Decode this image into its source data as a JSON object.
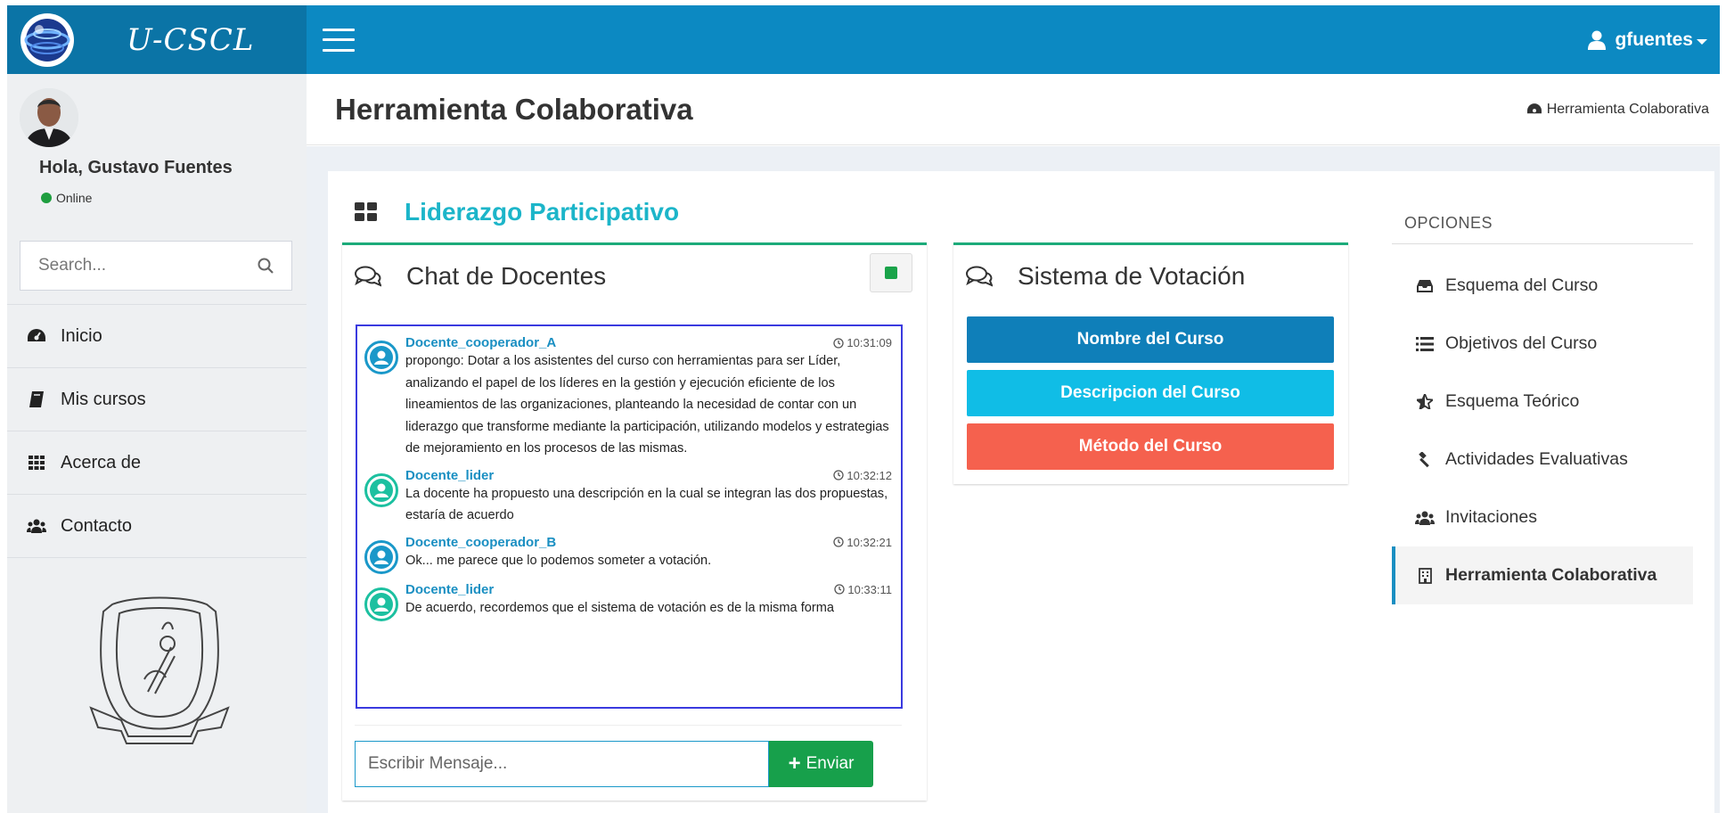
{
  "app": {
    "brand": "U-CSCL"
  },
  "header": {
    "username": "gfuentes"
  },
  "sidebar": {
    "greeting": "Hola, Gustavo Fuentes",
    "status": "Online",
    "search_placeholder": "Search...",
    "items": [
      {
        "label": "Inicio",
        "icon": "dashboard-icon"
      },
      {
        "label": "Mis cursos",
        "icon": "book-icon"
      },
      {
        "label": "Acerca de",
        "icon": "grid-icon"
      },
      {
        "label": "Contacto",
        "icon": "users-icon"
      }
    ]
  },
  "page": {
    "title": "Herramienta Colaborativa",
    "breadcrumb": "Herramienta Colaborativa",
    "section_title": "Liderazgo Participativo"
  },
  "chat": {
    "title": "Chat de Docentes",
    "messages": [
      {
        "author": "Docente_cooperador_A",
        "time": "10:31:09",
        "text": "propongo: Dotar a los asistentes del curso con herramientas para ser Líder, analizando el papel de los líderes en la gestión y ejecución eficiente de los lineamientos de las organizaciones, planteando la necesidad de contar con un liderazgo que transforme mediante la participación, utilizando modelos y estrategias de mejoramiento en los procesos de las mismas."
      },
      {
        "author": "Docente_lider",
        "time": "10:32:12",
        "text": "La docente ha propuesto una descripción en la cual se integran las dos propuestas, estaría de acuerdo"
      },
      {
        "author": "Docente_cooperador_B",
        "time": "10:32:21",
        "text": "Ok... me parece que lo podemos someter a votación."
      },
      {
        "author": "Docente_lider",
        "time": "10:33:11",
        "text": "De acuerdo, recordemos que el sistema de votación es de la misma forma"
      }
    ],
    "input_placeholder": "Escribir Mensaje...",
    "send_label": "Enviar"
  },
  "vote": {
    "title": "Sistema de Votación",
    "buttons": [
      {
        "label": "Nombre del Curso",
        "color": "#0f7fb9"
      },
      {
        "label": "Descripcion del Curso",
        "color": "#10bde6"
      },
      {
        "label": "Método del Curso",
        "color": "#f5614e"
      }
    ]
  },
  "options": {
    "title": "OPCIONES",
    "items": [
      {
        "label": "Esquema del Curso",
        "icon": "inbox-icon"
      },
      {
        "label": "Objetivos del Curso",
        "icon": "list-icon"
      },
      {
        "label": "Esquema Teórico",
        "icon": "star-icon"
      },
      {
        "label": "Actividades Evaluativas",
        "icon": "gavel-icon"
      },
      {
        "label": "Invitaciones",
        "icon": "users-icon"
      },
      {
        "label": "Herramienta Colaborativa",
        "icon": "building-icon",
        "active": true
      }
    ]
  },
  "colors": {
    "brand_dark": "#0b74a6",
    "brand": "#0c89c2",
    "accent_teal": "#1cb5c9",
    "box_border": "#1cab7a",
    "send_green": "#17a04b"
  }
}
